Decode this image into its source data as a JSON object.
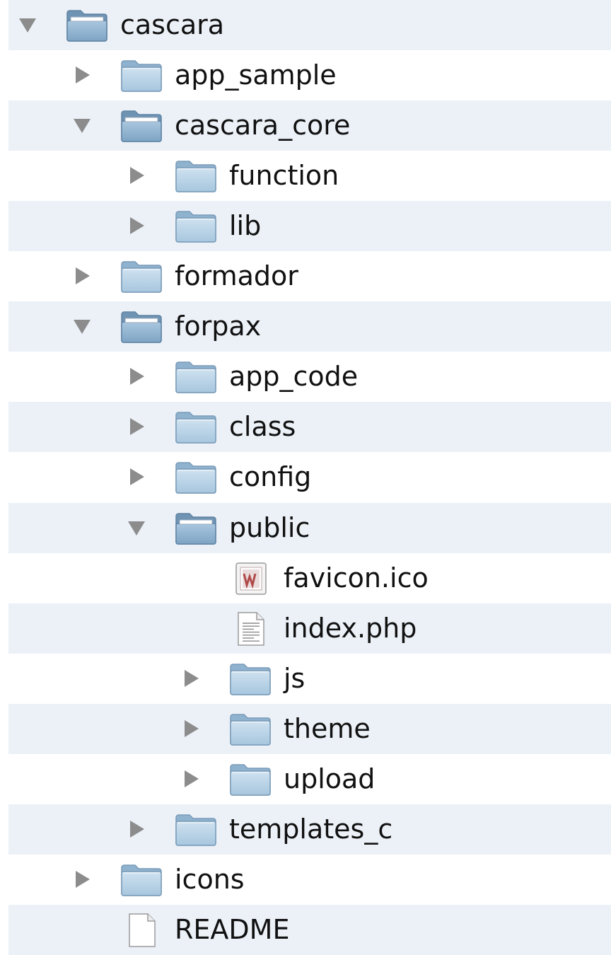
{
  "colors": {
    "alt_row": "#ecf1f8",
    "folder": "#a7c6de",
    "text": "#111111",
    "triangle": "#8c8c8c"
  },
  "tree": {
    "items": [
      {
        "label": "cascara",
        "depth": 0,
        "type": "folder",
        "expanded": true,
        "icon": "folder-icon"
      },
      {
        "label": "app_sample",
        "depth": 1,
        "type": "folder",
        "expanded": false,
        "icon": "folder-icon"
      },
      {
        "label": "cascara_core",
        "depth": 1,
        "type": "folder",
        "expanded": true,
        "icon": "folder-icon"
      },
      {
        "label": "function",
        "depth": 2,
        "type": "folder",
        "expanded": false,
        "icon": "folder-icon"
      },
      {
        "label": "lib",
        "depth": 2,
        "type": "folder",
        "expanded": false,
        "icon": "folder-icon"
      },
      {
        "label": "formador",
        "depth": 1,
        "type": "folder",
        "expanded": false,
        "icon": "folder-icon"
      },
      {
        "label": "forpax",
        "depth": 1,
        "type": "folder",
        "expanded": true,
        "icon": "folder-icon"
      },
      {
        "label": "app_code",
        "depth": 2,
        "type": "folder",
        "expanded": false,
        "icon": "folder-icon"
      },
      {
        "label": "class",
        "depth": 2,
        "type": "folder",
        "expanded": false,
        "icon": "folder-icon"
      },
      {
        "label": "config",
        "depth": 2,
        "type": "folder",
        "expanded": false,
        "icon": "folder-icon"
      },
      {
        "label": "public",
        "depth": 2,
        "type": "folder",
        "expanded": true,
        "icon": "folder-icon"
      },
      {
        "label": "favicon.ico",
        "depth": 3,
        "type": "file",
        "icon": "image-file-icon"
      },
      {
        "label": "index.php",
        "depth": 3,
        "type": "file",
        "icon": "text-file-icon"
      },
      {
        "label": "js",
        "depth": 3,
        "type": "folder",
        "expanded": false,
        "icon": "folder-icon"
      },
      {
        "label": "theme",
        "depth": 3,
        "type": "folder",
        "expanded": false,
        "icon": "folder-icon"
      },
      {
        "label": "upload",
        "depth": 3,
        "type": "folder",
        "expanded": false,
        "icon": "folder-icon"
      },
      {
        "label": "templates_c",
        "depth": 2,
        "type": "folder",
        "expanded": false,
        "icon": "folder-icon"
      },
      {
        "label": "icons",
        "depth": 1,
        "type": "folder",
        "expanded": false,
        "icon": "folder-icon"
      },
      {
        "label": "README",
        "depth": 1,
        "type": "file",
        "icon": "blank-file-icon"
      }
    ]
  }
}
